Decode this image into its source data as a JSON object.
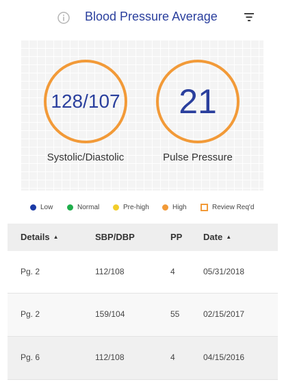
{
  "header": {
    "title": "Blood Pressure Average"
  },
  "icons": {
    "info": "info-icon",
    "filter": "filter-icon"
  },
  "summary": {
    "bp": {
      "value": "128/107",
      "label": "Systolic/Diastolic"
    },
    "pp": {
      "value": "21",
      "label": "Pulse Pressure"
    }
  },
  "legend": [
    {
      "label": "Low",
      "color": "#1b3aa6",
      "shape": "dot"
    },
    {
      "label": "Normal",
      "color": "#1fae4b",
      "shape": "dot"
    },
    {
      "label": "Pre-high",
      "color": "#f2cd2a",
      "shape": "dot"
    },
    {
      "label": "High",
      "color": "#f29a38",
      "shape": "dot"
    },
    {
      "label": "Review Req'd",
      "color": "#f29a38",
      "shape": "square"
    }
  ],
  "table": {
    "headers": [
      {
        "label": "Details",
        "sortable": true
      },
      {
        "label": "SBP/DBP",
        "sortable": false
      },
      {
        "label": "PP",
        "sortable": false
      },
      {
        "label": "Date",
        "sortable": true
      }
    ],
    "rows": [
      [
        "Pg. 2",
        "112/108",
        "4",
        "05/31/2018"
      ],
      [
        "Pg. 2",
        "159/104",
        "55",
        "02/15/2017"
      ],
      [
        "Pg. 6",
        "112/108",
        "4",
        "04/15/2016"
      ]
    ]
  },
  "colors": {
    "accent": "#2a3f9d",
    "ring": "#f29a38"
  }
}
